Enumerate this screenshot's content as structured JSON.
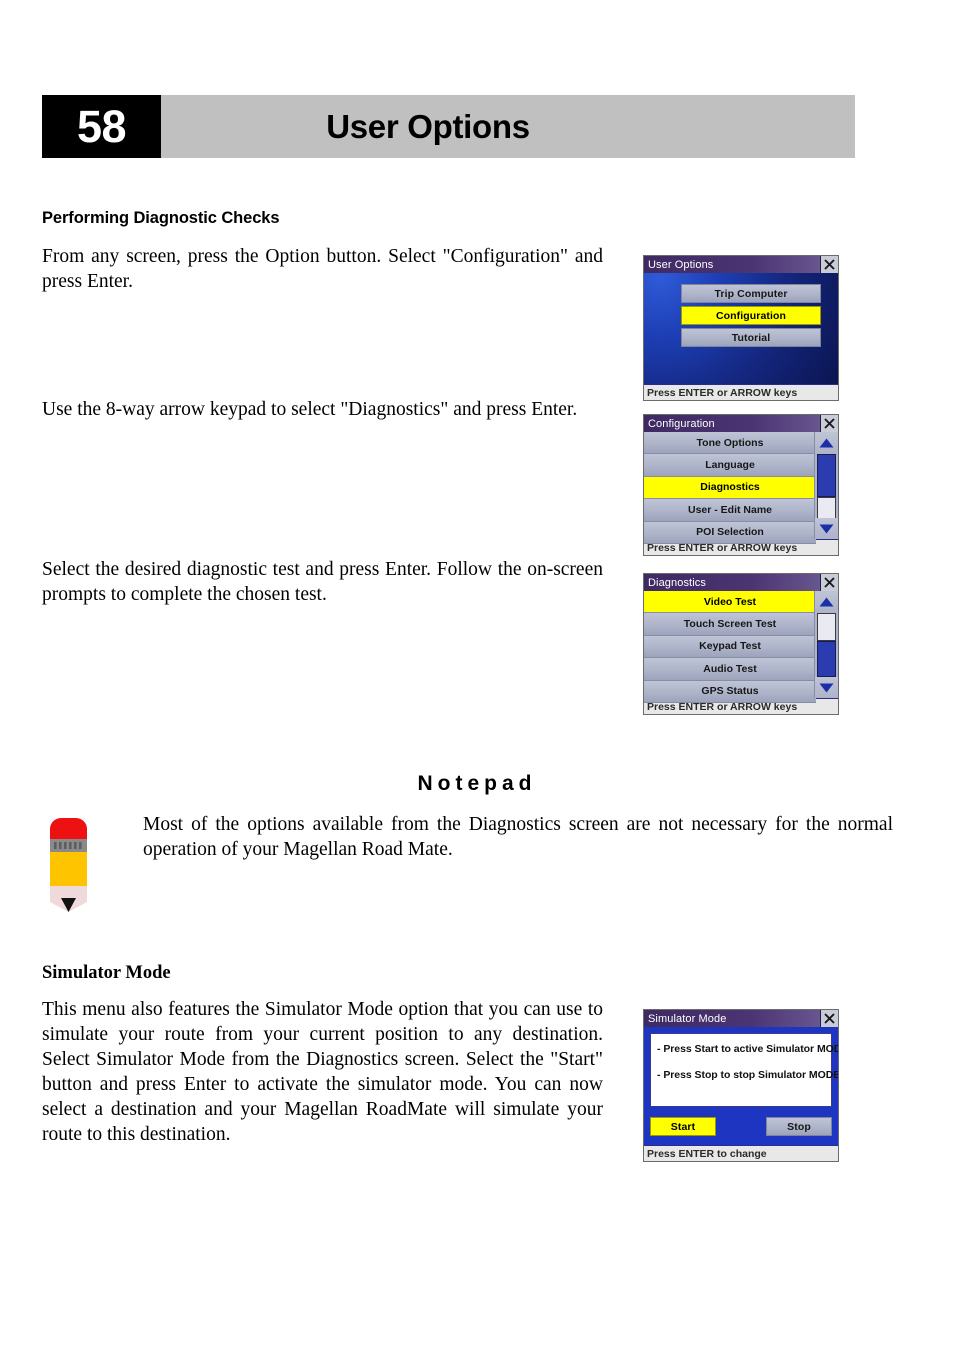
{
  "header": {
    "page_number": "58",
    "title": "User Options"
  },
  "sections": {
    "diagnostics": {
      "heading": "Performing Diagnostic Checks",
      "para1": "From any screen, press the Option button. Select \"Configuration\" and press Enter.",
      "para2": "Use the 8-way arrow keypad to select \"Diagnostics\" and press Enter.",
      "para3": "Select the desired diagnostic test and press Enter. Follow the on-screen prompts to complete the chosen test."
    },
    "notepad": {
      "title": "Notepad",
      "text": "Most of the options available from the Diagnostics screen are not necessary for the normal operation of your Magellan Road Mate."
    },
    "simulator": {
      "heading": "Simulator Mode",
      "para": "This menu also features the Simulator Mode option that you can use to simulate your route from your current position to any destination. Select Simulator Mode from the Diagnostics screen. Select the \"Start\" button and press Enter to activate the simulator mode. You can now select a destination and your Magellan RoadMate will simulate your route to this destination."
    }
  },
  "screens": {
    "user_options": {
      "title": "User Options",
      "close_icon": "close-x-icon",
      "buttons": [
        {
          "label": "Trip Computer",
          "highlighted": false
        },
        {
          "label": "Configuration",
          "highlighted": true
        },
        {
          "label": "Tutorial",
          "highlighted": false
        }
      ],
      "status": "Press ENTER or ARROW keys"
    },
    "configuration": {
      "title": "Configuration",
      "close_icon": "close-x-icon",
      "items": [
        {
          "label": "Tone Options",
          "highlighted": false
        },
        {
          "label": "Language",
          "highlighted": false
        },
        {
          "label": "Diagnostics",
          "highlighted": true
        },
        {
          "label": "User - Edit Name",
          "highlighted": false
        },
        {
          "label": "POI Selection",
          "highlighted": false
        }
      ],
      "scrollbar": {
        "up_icon": "scroll-up-arrow-icon",
        "down_icon": "scroll-down-arrow-icon",
        "thumb_position": "lower-middle"
      },
      "status": "Press ENTER or ARROW keys"
    },
    "diagnostics": {
      "title": "Diagnostics",
      "close_icon": "close-x-icon",
      "items": [
        {
          "label": "Video Test",
          "highlighted": true
        },
        {
          "label": "Touch Screen Test",
          "highlighted": false
        },
        {
          "label": "Keypad Test",
          "highlighted": false
        },
        {
          "label": "Audio Test",
          "highlighted": false
        },
        {
          "label": "GPS Status",
          "highlighted": false
        }
      ],
      "scrollbar": {
        "up_icon": "scroll-up-arrow-icon",
        "down_icon": "scroll-down-arrow-icon",
        "thumb_position": "top"
      },
      "status": "Press ENTER or ARROW keys"
    },
    "simulator_mode": {
      "title": "Simulator Mode",
      "close_icon": "close-x-icon",
      "lines": [
        "- Press Start to active Simulator MODE",
        "- Press Stop to stop Simulator MODE"
      ],
      "start_button": "Start",
      "stop_button": "Stop",
      "status": "Press ENTER to change"
    }
  },
  "icons": {
    "pencil": "pencil-icon"
  },
  "colors": {
    "highlight_yellow": "#ffff00",
    "titlebar_purple": "#3e2a63",
    "screen_blue": "#1d3fb5",
    "button_gray": "#aeb4c9",
    "header_gray": "#c0c0c0",
    "page_box_black": "#000000"
  }
}
